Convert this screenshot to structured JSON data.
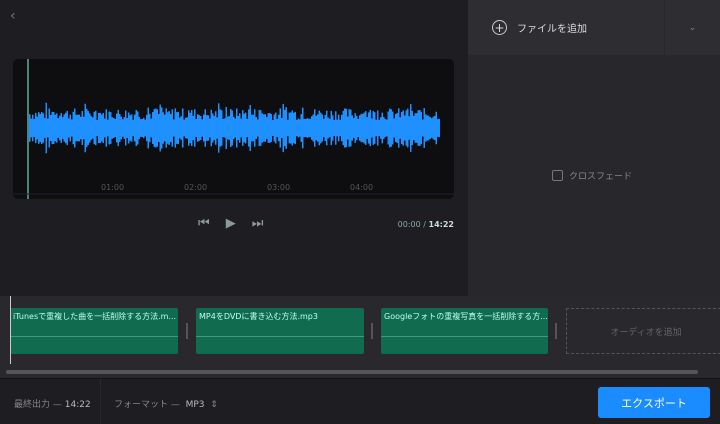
{
  "nav": {
    "back": "‹"
  },
  "player": {
    "ticks": [
      "01:00",
      "02:00",
      "03:00",
      "04:00"
    ],
    "current": "00:00",
    "separator": "/",
    "total": "14:22",
    "wave_color": "#1e90ff"
  },
  "sidebar": {
    "add_file": "ファイルを追加",
    "crossfade": "クロスフェード"
  },
  "timeline": {
    "clips": [
      "iTunesで重複した曲を一括削除する方法.m...",
      "MP4をDVDに書き込む方法.mp3",
      "Googleフォトの重複写真を一括削除する方..."
    ],
    "add_audio": "オーディオを追加",
    "clip_color": "#116b4f"
  },
  "footer": {
    "output_label": "最終出力 —",
    "output_value": "14:22",
    "format_label": "フォーマット —",
    "format_value": "MP3",
    "export": "エクスポート",
    "accent": "#1a8cff"
  }
}
